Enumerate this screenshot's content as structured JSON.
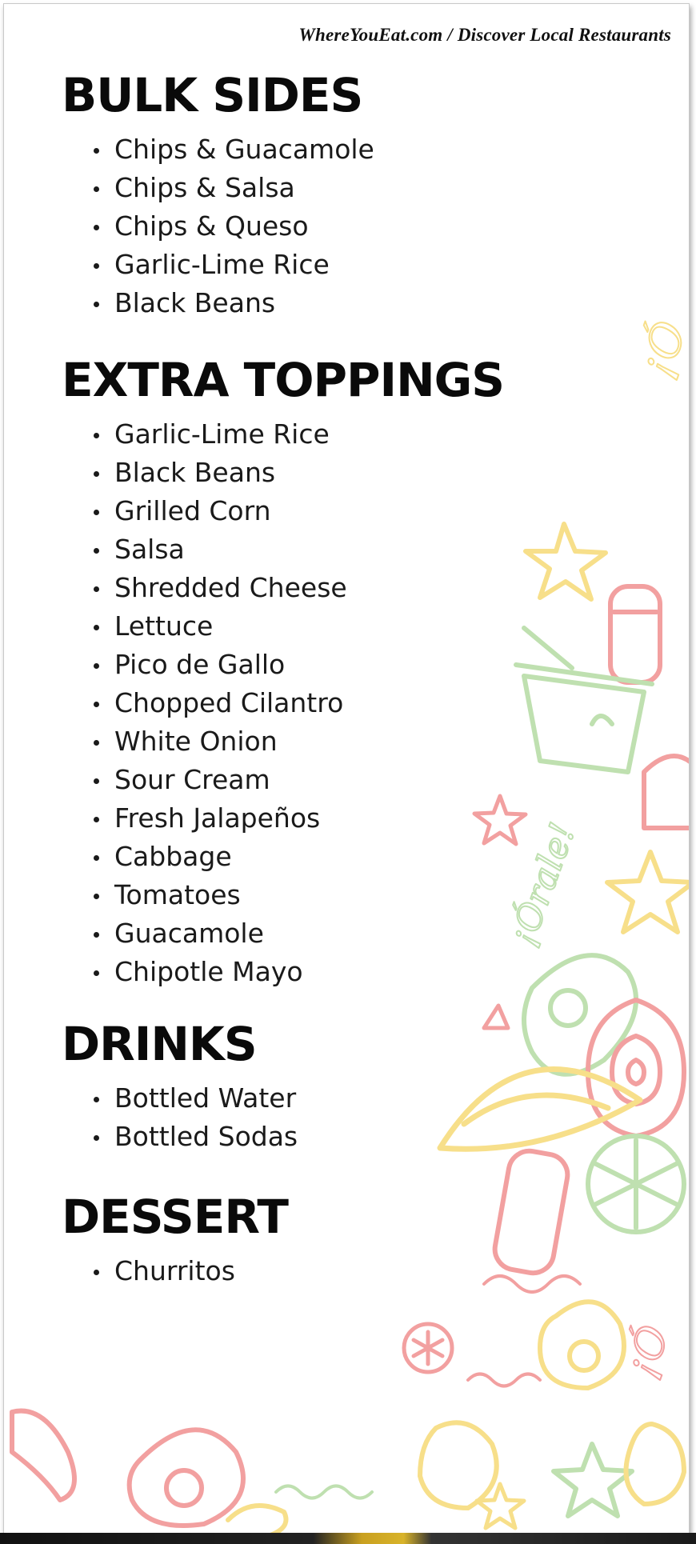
{
  "watermark": "WhereYouEat.com / Discover Local Restaurants",
  "sections": [
    {
      "heading": "BULK SIDES",
      "items": [
        "Chips & Guacamole",
        "Chips & Salsa",
        "Chips & Queso",
        "Garlic-Lime Rice",
        "Black Beans"
      ]
    },
    {
      "heading": "EXTRA TOPPINGS",
      "items": [
        "Garlic-Lime Rice",
        "Black Beans",
        "Grilled Corn",
        "Salsa",
        "Shredded Cheese",
        "Lettuce",
        "Pico de Gallo",
        "Chopped Cilantro",
        "White Onion",
        "Sour Cream",
        "Fresh Jalapeños",
        "Cabbage",
        "Tomatoes",
        "Guacamole",
        "Chipotle Mayo"
      ]
    },
    {
      "heading": "DRINKS",
      "items": [
        "Bottled Water",
        "Bottled Sodas"
      ]
    },
    {
      "heading": "DESSERT",
      "items": [
        "Churritos"
      ]
    }
  ],
  "decor": {
    "colors": {
      "red": "#f2a0a0",
      "yellow": "#f7df8a",
      "green": "#bfe0b0"
    },
    "script_text": [
      "¡Órale!",
      "¡Ó",
      "¡Ó"
    ]
  }
}
